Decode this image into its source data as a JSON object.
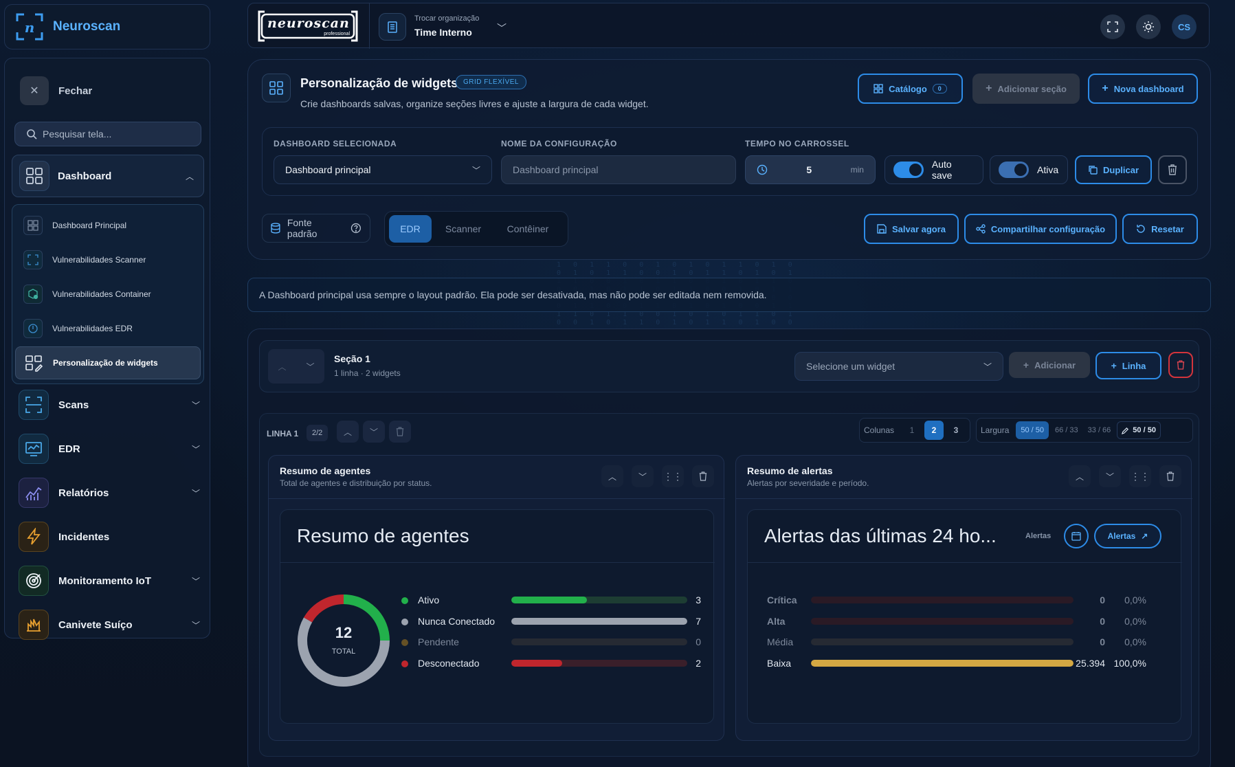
{
  "brand": {
    "name": "Neuroscan",
    "logo_text": "neuroscan",
    "logo_sub": "professional"
  },
  "sidebar": {
    "close_label": "Fechar",
    "search_placeholder": "Pesquisar tela...",
    "sections": [
      {
        "label": "Dashboard",
        "icon": "grid-icon"
      },
      {
        "label": "Scans",
        "icon": "scan-icon"
      },
      {
        "label": "EDR",
        "icon": "monitor-chart-icon"
      },
      {
        "label": "Relatórios",
        "icon": "line-chart-icon"
      },
      {
        "label": "Incidentes",
        "icon": "bolt-icon"
      },
      {
        "label": "Monitoramento IoT",
        "icon": "radar-icon"
      },
      {
        "label": "Canivete Suíço",
        "icon": "tools-icon"
      }
    ],
    "dashboard_items": [
      {
        "label": "Dashboard Principal",
        "icon": "grid-icon"
      },
      {
        "label": "Vulnerabilidades Scanner",
        "icon": "scan-icon"
      },
      {
        "label": "Vulnerabilidades Container",
        "icon": "container-icon"
      },
      {
        "label": "Vulnerabilidades EDR",
        "icon": "shield-icon"
      },
      {
        "label": "Personalização de widgets",
        "icon": "widgets-edit-icon"
      }
    ]
  },
  "topbar": {
    "org_caption": "Trocar organização",
    "org_name": "Time Interno",
    "avatar_initials": "CS"
  },
  "widgets_header": {
    "title": "Personalização de widgets",
    "badge": "GRID FLEXÍVEL",
    "subtitle": "Crie dashboards salvas, organize seções livres e ajuste a largura de cada widget.",
    "catalog_label": "Catálogo",
    "catalog_count": "0",
    "add_section_label": "Adicionar seção",
    "new_dashboard_label": "Nova dashboard"
  },
  "config": {
    "selected_label": "DASHBOARD SELECIONADA",
    "selected_value": "Dashboard principal",
    "name_label": "NOME DA CONFIGURAÇÃO",
    "name_placeholder": "Dashboard principal",
    "carousel_label": "TEMPO NO CARROSSEL",
    "carousel_value": "5",
    "carousel_unit": "min",
    "autosave_label": "Auto save",
    "active_label": "Ativa",
    "duplicate_label": "Duplicar"
  },
  "source": {
    "label": "Fonte padrão",
    "tabs": [
      "EDR",
      "Scanner",
      "Contêiner"
    ],
    "active_tab": "EDR",
    "save_now": "Salvar agora",
    "share": "Compartilhar configuração",
    "reset": "Resetar"
  },
  "info_banner": "A Dashboard principal usa sempre o layout padrão. Ela pode ser desativada, mas não pode ser editada nem removida.",
  "section": {
    "title": "Seção 1",
    "meta": "1 linha · 2 widgets",
    "widget_select_placeholder": "Selecione um widget",
    "add_label": "Adicionar",
    "line_label": "Linha"
  },
  "row": {
    "label": "LINHA 1",
    "count": "2/2",
    "columns_label": "Colunas",
    "columns_options": [
      "1",
      "2",
      "3"
    ],
    "columns_selected": "2",
    "width_label": "Largura",
    "width_options": [
      "50 / 50",
      "66 / 33",
      "33 / 66"
    ],
    "width_selected": "50 / 50",
    "width_custom": "50 / 50"
  },
  "widget_agents": {
    "title": "Resumo de agentes",
    "subtitle": "Total de agentes e distribuição por status.",
    "card_title": "Resumo de agentes",
    "total": "12",
    "total_label": "TOTAL",
    "items": [
      {
        "label": "Ativo",
        "value": "3",
        "fraction": 0.43,
        "color": "#22b04b",
        "track": "#1d3d33"
      },
      {
        "label": "Nunca Conectado",
        "value": "7",
        "fraction": 1.0,
        "color": "#9ca3af",
        "track": "#3b4150"
      },
      {
        "label": "Pendente",
        "value": "0",
        "fraction": 0.0,
        "color": "#8a6a22",
        "track": "#262a33"
      },
      {
        "label": "Desconectado",
        "value": "2",
        "fraction": 0.29,
        "color": "#c0262d",
        "track": "#3a1f2a"
      }
    ],
    "donut": [
      {
        "value": 3,
        "color": "#22b04b"
      },
      {
        "value": 7,
        "color": "#9ca3af"
      },
      {
        "value": 2,
        "color": "#c0262d"
      }
    ]
  },
  "widget_alerts": {
    "title": "Resumo de alertas",
    "subtitle": "Alertas por severidade e período.",
    "card_title": "Alertas das últimas 24 ho...",
    "tag": "Alertas",
    "link_label": "Alertas",
    "items": [
      {
        "label": "Crítica",
        "value": "0",
        "pct": "0,0%",
        "fraction": 0.0,
        "color": "#7a2330",
        "track": "#2a1a25",
        "bold": true,
        "dim": true
      },
      {
        "label": "Alta",
        "value": "0",
        "pct": "0,0%",
        "fraction": 0.0,
        "color": "#7a2330",
        "track": "#2a1a25",
        "bold": true,
        "dim": true
      },
      {
        "label": "Média",
        "value": "0",
        "pct": "0,0%",
        "fraction": 0.0,
        "color": "#8a6a22",
        "track": "#262a33",
        "bold": false,
        "dim": true
      },
      {
        "label": "Baixa",
        "value": "25.394",
        "pct": "100,0%",
        "fraction": 1.0,
        "color": "#d4a843",
        "track": "#3a3224",
        "bold": false,
        "dim": false
      }
    ]
  },
  "colors": {
    "accent": "#2d8ce8",
    "danger": "#e04550",
    "bg": "#0b1425"
  }
}
